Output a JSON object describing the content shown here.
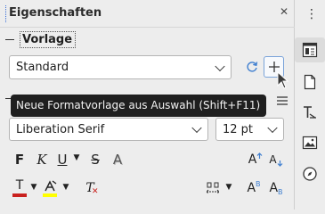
{
  "deck": {
    "title": "Eigenschaften",
    "close_icon": "close-icon"
  },
  "style_panel": {
    "title": "Vorlage",
    "style_value": "Standard",
    "update_icon": "refresh-icon",
    "new_style_icon": "plus-icon"
  },
  "tooltip": {
    "text": "Neue Formatvorlage aus Auswahl (Shift+F11)"
  },
  "character_panel": {
    "font_name": "Liberation Serif",
    "font_size": "12 pt",
    "bold_label": "F",
    "italic_label": "K",
    "underline_label": "U",
    "strikethrough_label": "S",
    "shadow_label": "A",
    "grow_label": "A",
    "shrink_label": "A",
    "font_color_label": "T",
    "clear_label": "T",
    "superscript_label": "A",
    "subscript_label": "A"
  },
  "tabbar": {
    "items": [
      "properties-tab",
      "page-tab",
      "styles-tab",
      "gallery-tab",
      "navigator-tab"
    ]
  }
}
